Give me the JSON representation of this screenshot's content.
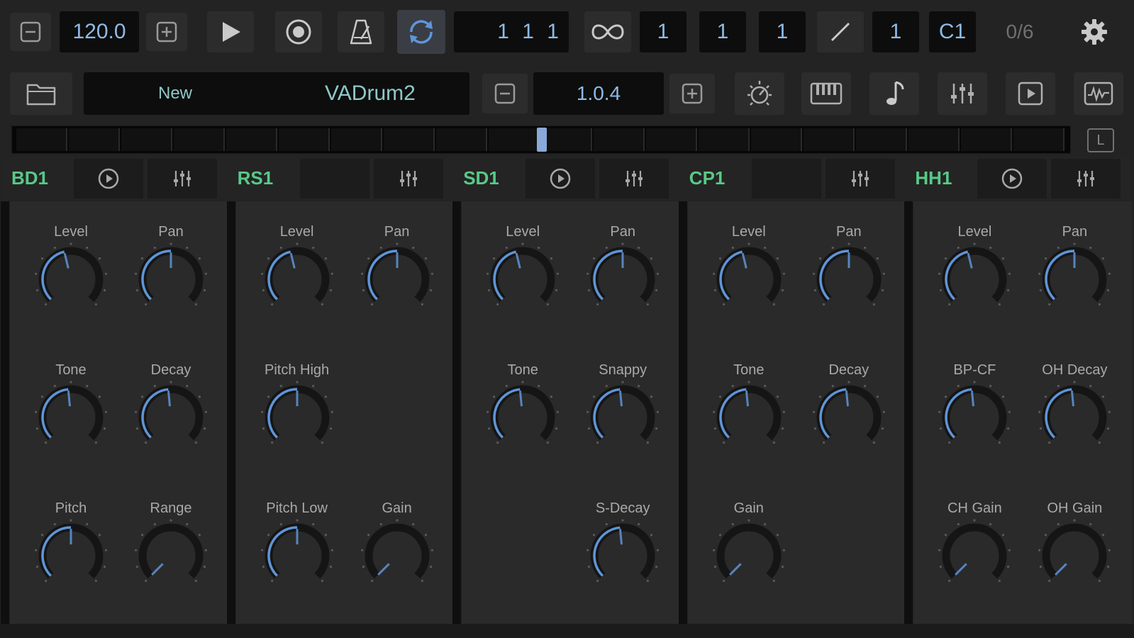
{
  "transport": {
    "tempo": "120.0",
    "position": "1  1  1",
    "loop_bar": "1",
    "loop_beat": "1",
    "loop_tick": "1",
    "quantize": "1",
    "root_note": "C1",
    "voices": "0/6"
  },
  "patch": {
    "bank": "New",
    "name": "VADrum2",
    "version": "1.0.4"
  },
  "timeline": {
    "lock_label": "L"
  },
  "colors": {
    "accent_blue": "#5f95d8",
    "instrument_green": "#59c987",
    "display_text": "#8fbbe6"
  },
  "instruments": [
    {
      "name": "BD1",
      "has_play": true,
      "knobs": [
        {
          "label": "Level",
          "value": 0.45
        },
        {
          "label": "Pan",
          "value": 0.5
        },
        {
          "label": "Tone",
          "value": 0.48
        },
        {
          "label": "Decay",
          "value": 0.48
        },
        {
          "label": "Pitch",
          "value": 0.5
        },
        {
          "label": "Range",
          "value": 0.0
        }
      ]
    },
    {
      "name": "RS1",
      "has_play": false,
      "knobs": [
        {
          "label": "Level",
          "value": 0.45
        },
        {
          "label": "Pan",
          "value": 0.5
        },
        {
          "label": "Pitch High",
          "value": 0.5
        },
        null,
        {
          "label": "Pitch Low",
          "value": 0.5
        },
        {
          "label": "Gain",
          "value": 0.0
        }
      ]
    },
    {
      "name": "SD1",
      "has_play": true,
      "knobs": [
        {
          "label": "Level",
          "value": 0.45
        },
        {
          "label": "Pan",
          "value": 0.5
        },
        {
          "label": "Tone",
          "value": 0.48
        },
        {
          "label": "Snappy",
          "value": 0.48
        },
        null,
        {
          "label": "S-Decay",
          "value": 0.48
        }
      ]
    },
    {
      "name": "CP1",
      "has_play": false,
      "knobs": [
        {
          "label": "Level",
          "value": 0.45
        },
        {
          "label": "Pan",
          "value": 0.5
        },
        {
          "label": "Tone",
          "value": 0.48
        },
        {
          "label": "Decay",
          "value": 0.48
        },
        {
          "label": "Gain",
          "value": 0.0
        },
        null
      ]
    },
    {
      "name": "HH1",
      "has_play": true,
      "knobs": [
        {
          "label": "Level",
          "value": 0.45
        },
        {
          "label": "Pan",
          "value": 0.5
        },
        {
          "label": "BP-CF",
          "value": 0.48
        },
        {
          "label": "OH Decay",
          "value": 0.48
        },
        {
          "label": "CH Gain",
          "value": 0.0
        },
        {
          "label": "OH Gain",
          "value": 0.0
        }
      ]
    }
  ]
}
